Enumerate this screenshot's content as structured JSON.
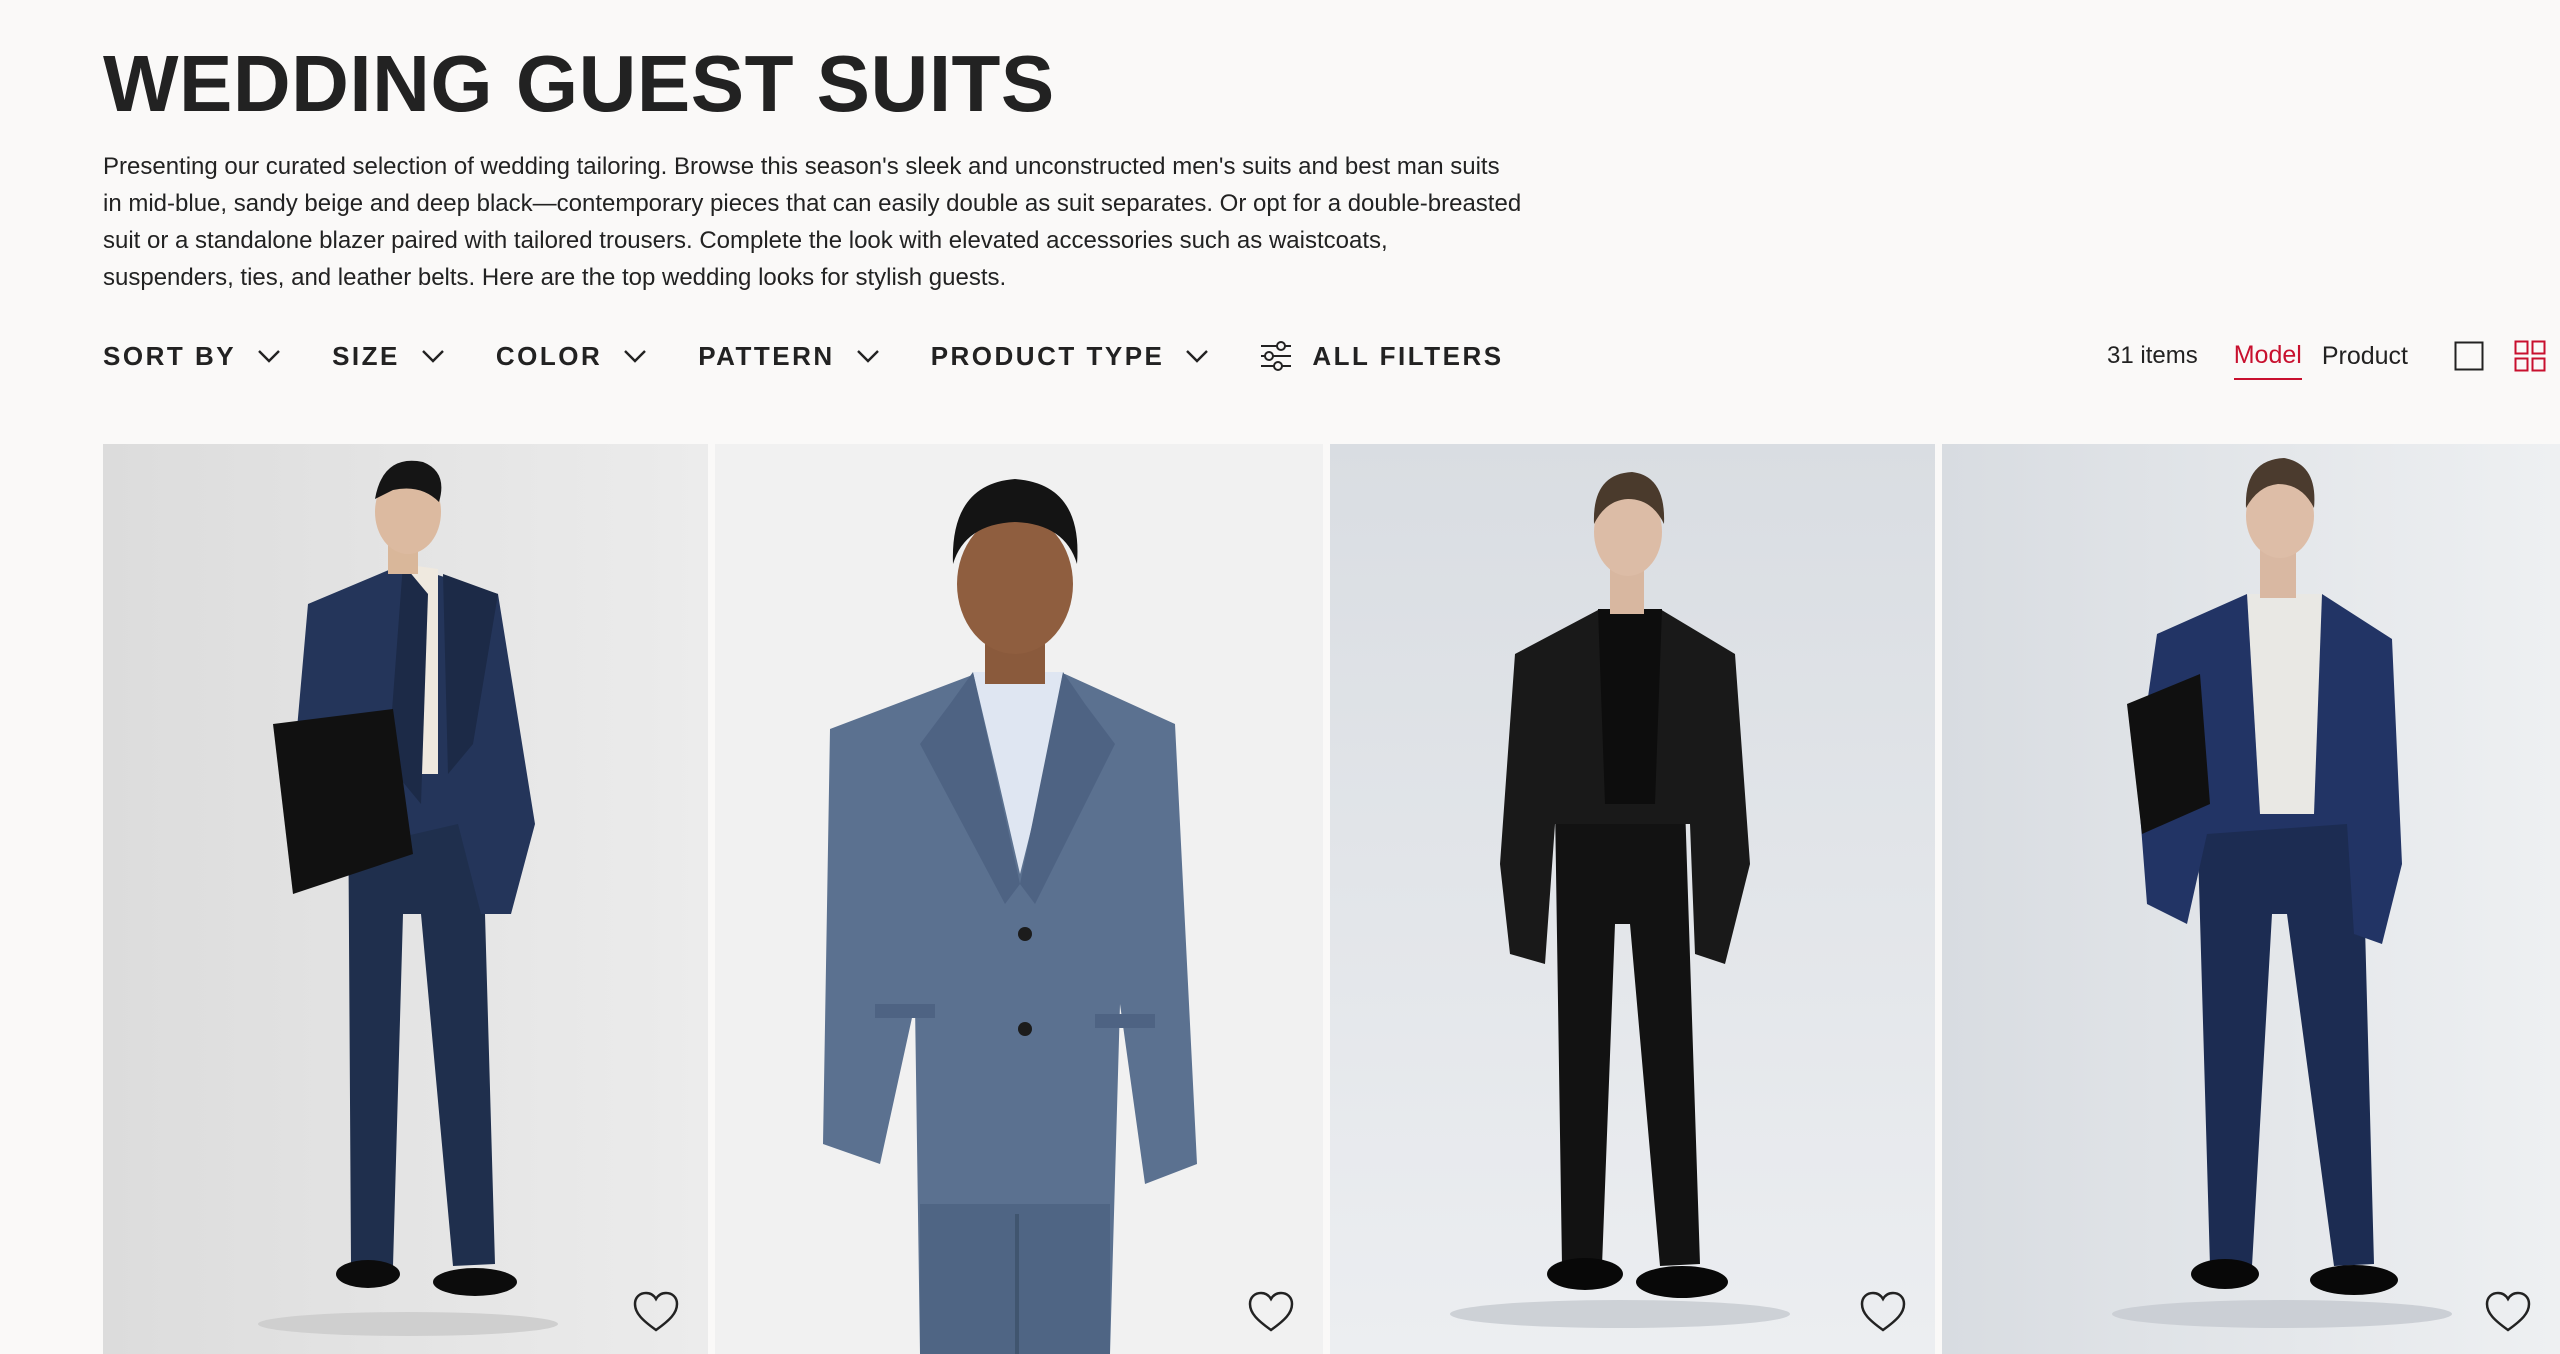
{
  "page": {
    "title": "WEDDING GUEST SUITS",
    "description": "Presenting our curated selection of wedding tailoring. Browse this season's sleek and unconstructed men's suits and best man suits in mid-blue, sandy beige and deep black—contemporary pieces that can easily double as suit separates. Or opt for a double-breasted suit or a standalone blazer paired with tailored trousers. Complete the look with elevated accessories such as waistcoats, suspenders, ties, and leather belts. Here are the top wedding looks for stylish guests."
  },
  "filters": {
    "sort_by": "SORT BY",
    "size": "SIZE",
    "color": "COLOR",
    "pattern": "PATTERN",
    "product_type": "PRODUCT TYPE",
    "all_filters": "ALL FILTERS"
  },
  "view": {
    "item_count": "31 items",
    "model_label": "Model",
    "product_label": "Product",
    "active_tab": "Model",
    "accent_color": "#c8102e"
  },
  "products": [
    {
      "suit_color": "#1f2f4d",
      "shirt_color": "#efe9df",
      "background": "#e3e3e3",
      "accessory": "black leather bag",
      "favorite_icon": "heart-outline-icon"
    },
    {
      "suit_color": "#5b7190",
      "shirt_color": "#dfe6f2",
      "background": "#f1f1f1",
      "accessory": "none",
      "favorite_icon": "heart-outline-icon"
    },
    {
      "suit_color": "#151515",
      "shirt_color": "#151515",
      "background": "#e3e6ea",
      "accessory": "none",
      "favorite_icon": "heart-outline-icon"
    },
    {
      "suit_color": "#1c2c52",
      "shirt_color": "#e9e8e4",
      "background": "#dfe2e6",
      "accessory": "black leather bag",
      "favorite_icon": "heart-outline-icon"
    }
  ]
}
